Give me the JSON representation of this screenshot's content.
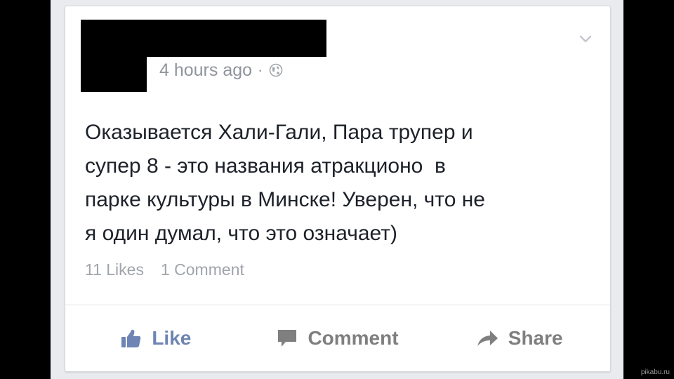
{
  "post": {
    "time": "4 hours ago",
    "separator": "·",
    "text": "Оказывается Хали-Гали, Пара трупер и\nсупер 8 - это названия атракционо  в\nпарке культуры в Минске! Уверен, что не\nя один думал, что это означает)",
    "likes": "11 Likes",
    "comments": "1 Comment"
  },
  "actions": {
    "like_label": "Like",
    "comment_label": "Comment",
    "share_label": "Share"
  },
  "icons": {
    "menu": "chevron-down-icon",
    "privacy": "globe-icon",
    "like": "thumbs-up-icon",
    "comment": "speech-bubble-icon",
    "share": "share-arrow-icon"
  },
  "colors": {
    "like_accent": "#6d84b4",
    "action_gray": "#7f7f7f",
    "meta_gray": "#90949c"
  },
  "watermark": "pikabu.ru"
}
